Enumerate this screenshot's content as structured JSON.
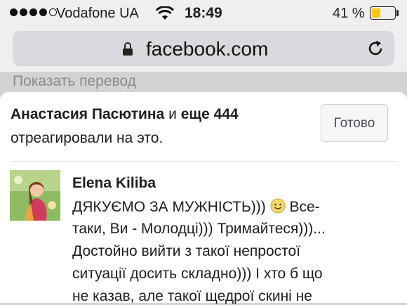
{
  "status_bar": {
    "carrier": "Vodafone UA",
    "time": "18:49",
    "battery_percent": "41 %",
    "battery_level": 0.41,
    "signal_bars_filled": 4,
    "signal_bars_total": 5
  },
  "address_bar": {
    "url": "facebook.com"
  },
  "background_page": {
    "translate_link": "Показать перевод"
  },
  "reactions_sheet": {
    "reactor_name": "Анастасия Пасютина",
    "connector": "и",
    "others": "еще 444",
    "reacted_text": "отреагировали на это.",
    "done_label": "Готово"
  },
  "comment": {
    "author": "Elena Kiliba",
    "line1_text": "ДЯКУЄМО ЗА МУЖНІСТЬ)))",
    "line1_after": "Все-",
    "line2": "таки, Ви - Молодці))) Тримайтеся)))...",
    "line3": "Достойно вийти з такої непростої",
    "line4": "ситуації досить складно))) І хто б що",
    "line5": "не казав, але такої щедрої скині не"
  },
  "colors": {
    "battery_fill": "#f6c90e",
    "sheet_bg": "#ffffff",
    "page_bg": "#d3d3d3"
  }
}
